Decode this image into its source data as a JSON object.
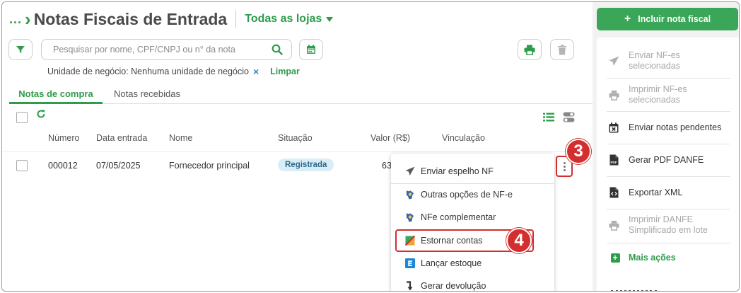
{
  "header": {
    "breadcrumb": "...",
    "title": "Notas Fiscais de Entrada",
    "store_selector": "Todas as lojas"
  },
  "search": {
    "placeholder": "Pesquisar por nome, CPF/CNPJ ou n° da nota"
  },
  "filter": {
    "label": "Unidade de negócio: Nenhuma unidade de negócio",
    "remove": "×",
    "clear": "Limpar"
  },
  "tabs": [
    {
      "label": "Notas de compra",
      "active": true
    },
    {
      "label": "Notas recebidas",
      "active": false
    }
  ],
  "table": {
    "columns": [
      "Número",
      "Data entrada",
      "Nome",
      "Situação",
      "Valor (R$)",
      "Vinculação"
    ],
    "rows": [
      {
        "numero": "000012",
        "data": "07/05/2025",
        "nome": "Fornecedor principal",
        "situacao": "Registrada",
        "valor": "63"
      }
    ]
  },
  "row_menu": {
    "items": [
      {
        "label": "Enviar espelho NF",
        "icon": "send-icon"
      },
      {
        "label": "Outras opções de NF-e",
        "icon": "nfe-icon"
      },
      {
        "label": "NFe complementar",
        "icon": "nfe-icon"
      },
      {
        "label": "Estornar contas",
        "icon": "estorno-icon"
      },
      {
        "label": "Lançar estoque",
        "icon": "estoque-icon"
      },
      {
        "label": "Gerar devolução",
        "icon": "return-arrow-icon"
      }
    ]
  },
  "markers": {
    "step3": "3",
    "step4": "4"
  },
  "sidebar": {
    "include_button": "Incluir nota fiscal",
    "include_icon": "+",
    "items": [
      {
        "label_1": "Enviar NF-es",
        "label_2": "selecionadas",
        "enabled": false,
        "icon": "send-icon"
      },
      {
        "label_1": "Imprimir NF-es",
        "label_2": "selecionadas",
        "enabled": false,
        "icon": "printer-icon"
      },
      {
        "label_1": "Enviar notas pendentes",
        "enabled": true,
        "icon": "calendar-x-icon"
      },
      {
        "label_1": "Gerar PDF DANFE",
        "enabled": true,
        "icon": "pdf-icon"
      },
      {
        "label_1": "Exportar XML",
        "enabled": true,
        "icon": "xml-file-icon"
      },
      {
        "label_1": "Imprimir DANFE",
        "label_2": "Simplificado em lote",
        "enabled": false,
        "icon": "printer-icon"
      }
    ],
    "more": "Mais ações",
    "more_icon": "+"
  },
  "colors": {
    "brand_green": "#2e9c4a",
    "button_green": "#3aa657",
    "marker_red": "#d32f2f",
    "badge_bg": "#d9edf7"
  }
}
